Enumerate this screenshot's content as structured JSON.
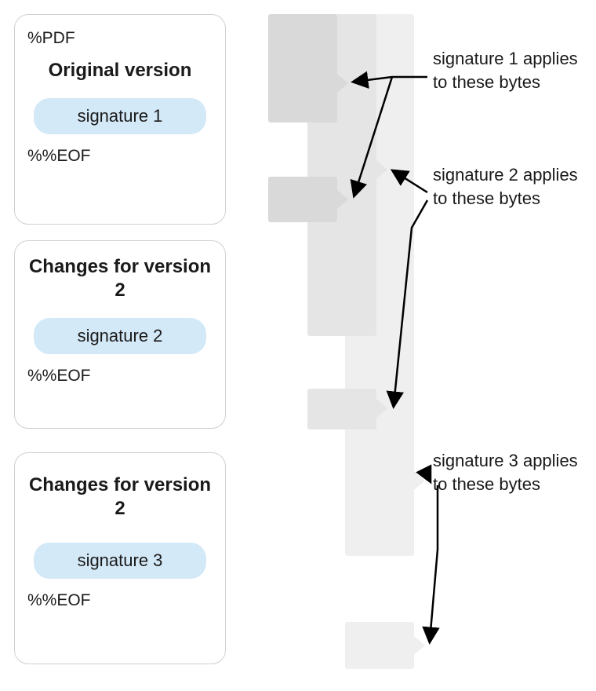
{
  "boxes": [
    {
      "top_label": "%PDF",
      "title": "Original version",
      "signature": "signature 1",
      "eof": "%%EOF"
    },
    {
      "top_label": "",
      "title": "Changes for version 2",
      "signature": "signature 2",
      "eof": "%%EOF"
    },
    {
      "top_label": "",
      "title": "Changes for version 2",
      "signature": "signature 3",
      "eof": "%%EOF"
    }
  ],
  "annotations": [
    {
      "text": "signature 1 applies to these bytes"
    },
    {
      "text": "signature 2 applies to these bytes"
    },
    {
      "text": "signature 3 applies to these bytes"
    }
  ]
}
